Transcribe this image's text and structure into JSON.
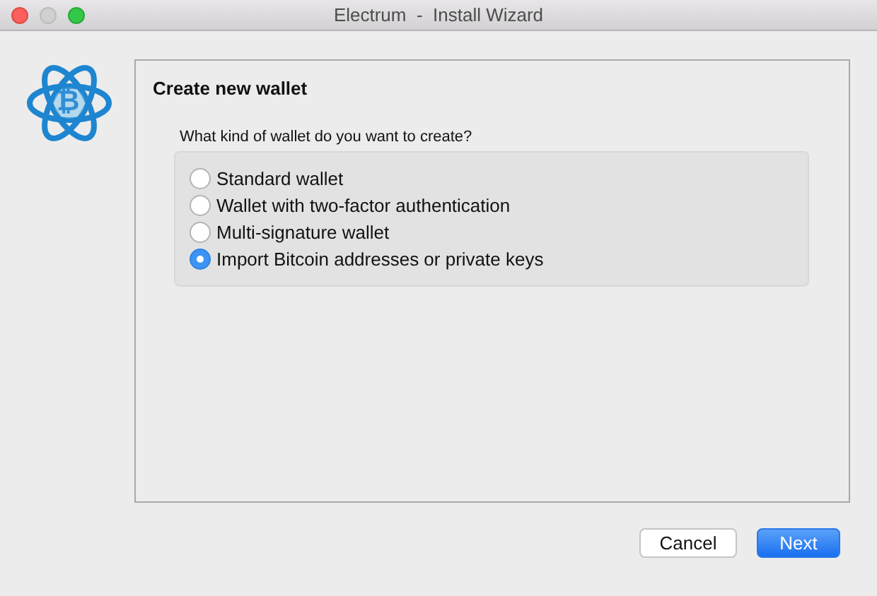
{
  "window": {
    "title": "Electrum  -  Install Wizard"
  },
  "logo": {
    "glyph": "₿"
  },
  "page": {
    "title": "Create new wallet",
    "question": "What kind of wallet do you want to create?"
  },
  "options": [
    {
      "label": "Standard wallet",
      "selected": false
    },
    {
      "label": "Wallet with two-factor authentication",
      "selected": false
    },
    {
      "label": "Multi-signature wallet",
      "selected": false
    },
    {
      "label": "Import Bitcoin addresses or private keys",
      "selected": true
    }
  ],
  "buttons": [
    {
      "label": "Cancel",
      "kind": "secondary"
    },
    {
      "label": "Next",
      "kind": "primary"
    }
  ]
}
